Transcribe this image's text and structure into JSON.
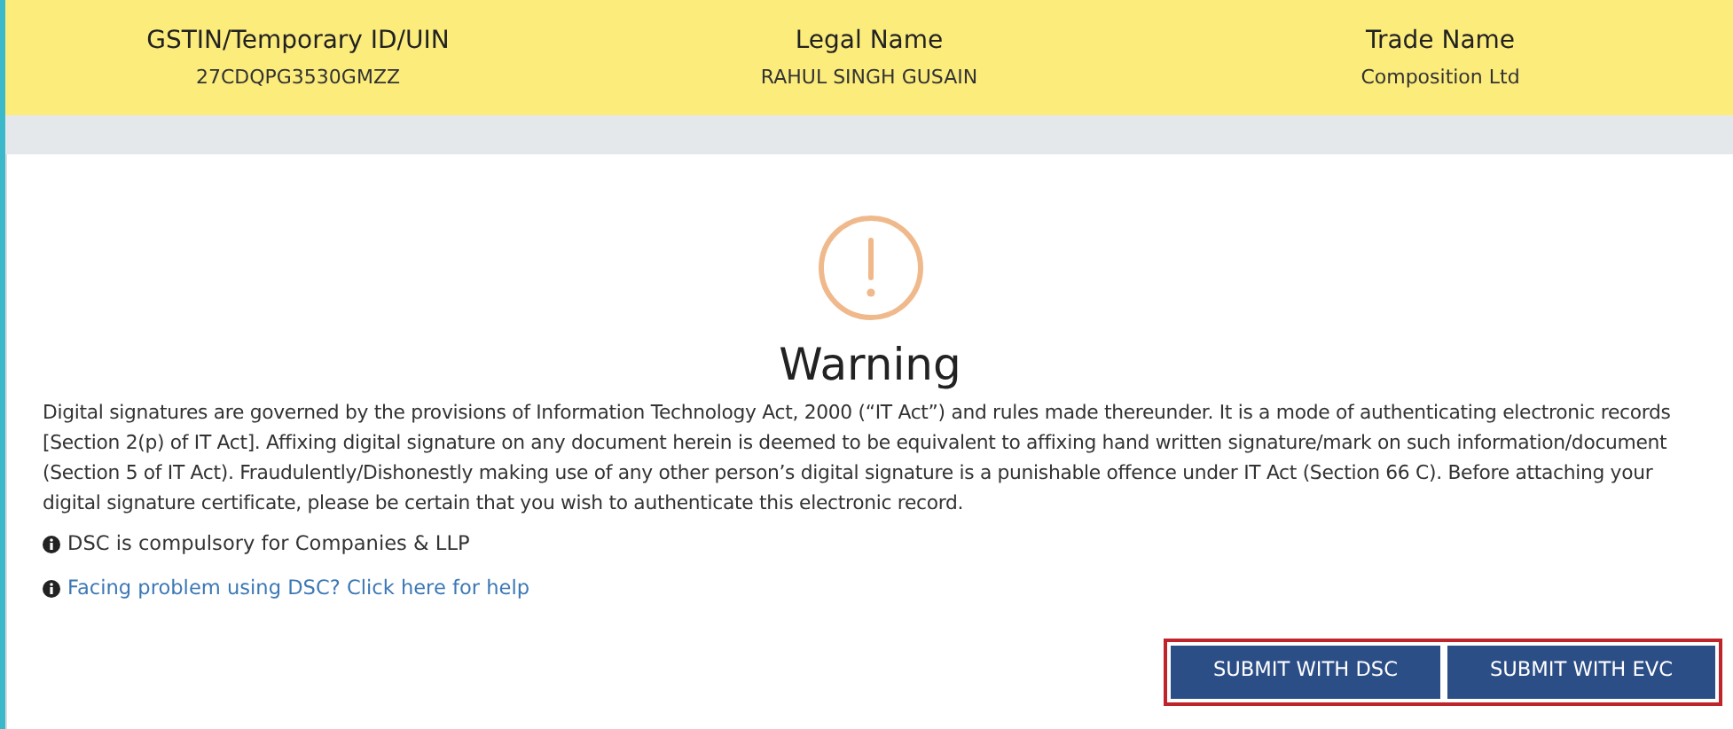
{
  "taxpayer": [
    {
      "label": "GSTIN/Temporary ID/UIN",
      "value": "27CDQPG3530GMZZ"
    },
    {
      "label": "Legal Name",
      "value": "RAHUL SINGH GUSAIN"
    },
    {
      "label": "Trade Name",
      "value": "Composition Ltd"
    }
  ],
  "dialog": {
    "title": "Warning",
    "message": "Digital signatures are governed by the provisions of Information Technology Act, 2000 (“IT Act”) and rules made thereunder. It is a mode of authenticating electronic records [Section 2(p) of IT Act]. Affixing digital signature on any document herein is deemed to be equivalent to affixing hand written signature/mark on such information/document (Section 5 of IT Act). Fraudulently/Dishonestly making use of any other person’s digital signature is a punishable offence under IT Act (Section 66 C). Before attaching your digital signature certificate, please be certain that you wish to authenticate this electronic record.",
    "notes": [
      {
        "kind": "text",
        "text": "DSC is compulsory for Companies & LLP"
      },
      {
        "kind": "link",
        "text": "Facing problem using DSC? Click here for help"
      }
    ],
    "buttons_highlighted": true,
    "buttons": [
      "SUBMIT WITH DSC",
      "SUBMIT WITH EVC"
    ]
  }
}
